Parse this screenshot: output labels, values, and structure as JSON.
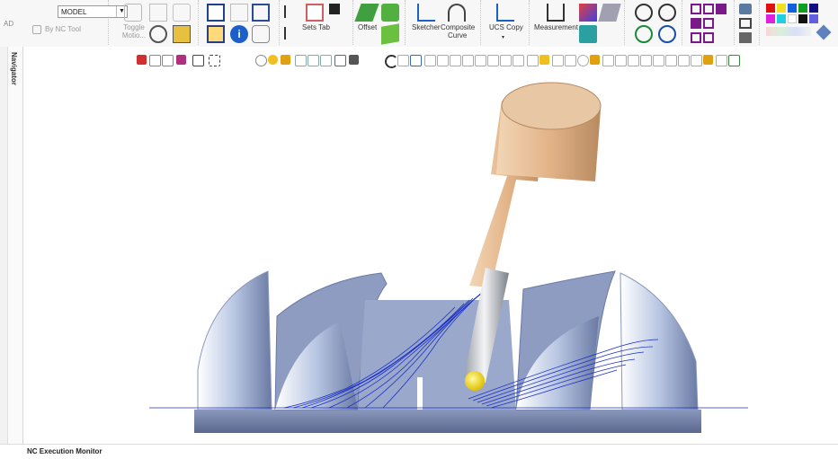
{
  "ribbon": {
    "left_label": "AD",
    "model_select": {
      "value": "MODEL"
    },
    "by_nc_tool": "By NC Tool",
    "toggle_motion": "Toggle Motio...",
    "sets_tab": "Sets Tab",
    "offset": "Offset",
    "sketcher": "Sketcher",
    "composite_curve_1": "Composite",
    "composite_curve_2": "Curve",
    "ucs_copy": "UCS Copy",
    "measurement": "Measurement"
  },
  "navigator": {
    "label": "Navigator"
  },
  "status_bar": {
    "label": "NC Execution Monitor"
  },
  "colors": {
    "part": "#7a8ab0",
    "tool_holder": "#e6b98e",
    "toolpath": "#1b2fc8",
    "tool_tip": "#ffe600"
  }
}
